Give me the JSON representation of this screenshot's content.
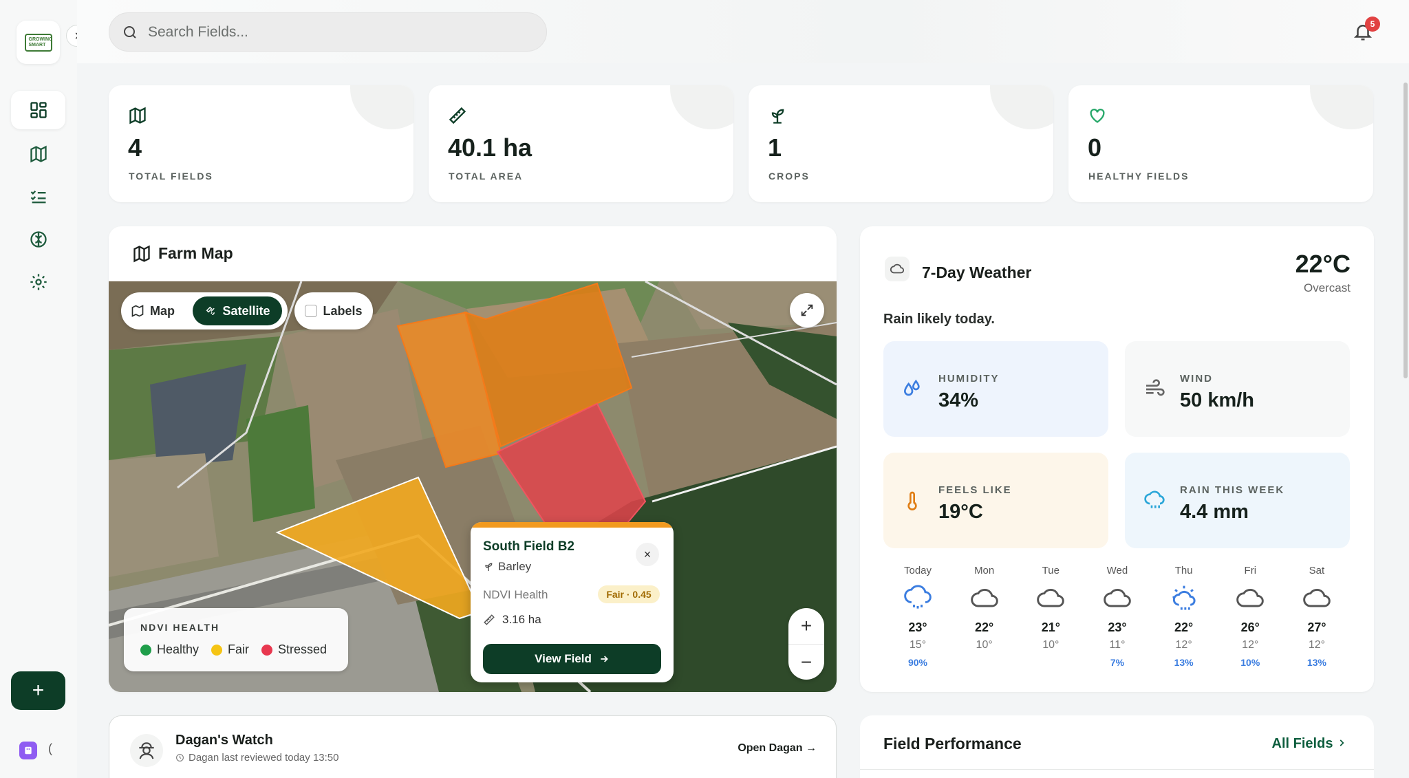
{
  "app": {
    "logo_text_1": "GROWING",
    "logo_text_2": "SMART"
  },
  "header": {
    "search_placeholder": "Search Fields...",
    "notification_count": "5"
  },
  "stats": [
    {
      "value": "4",
      "label": "TOTAL FIELDS",
      "icon": "map-icon"
    },
    {
      "value": "40.1 ha",
      "label": "TOTAL AREA",
      "icon": "ruler-icon"
    },
    {
      "value": "1",
      "label": "CROPS",
      "icon": "sprout-icon"
    },
    {
      "value": "0",
      "label": "HEALTHY FIELDS",
      "icon": "heart-icon"
    }
  ],
  "farm_map": {
    "title": "Farm Map",
    "toggle_map": "Map",
    "toggle_satellite": "Satellite",
    "labels": "Labels",
    "legend_title": "NDVI HEALTH",
    "legend": [
      {
        "label": "Healthy",
        "color": "#1f9e4a"
      },
      {
        "label": "Fair",
        "color": "#f5c414"
      },
      {
        "label": "Stressed",
        "color": "#e8384f"
      }
    ],
    "popup": {
      "title": "South Field B2",
      "crop": "Barley",
      "ndvi_label": "NDVI Health",
      "ndvi_badge": "Fair · 0.45",
      "area": "3.16 ha",
      "button": "View Field"
    },
    "zoom_in": "+",
    "zoom_out": "−"
  },
  "weather": {
    "title": "7-Day Weather",
    "temp": "22°C",
    "condition": "Overcast",
    "summary": "Rain likely today.",
    "metrics": [
      {
        "label": "HUMIDITY",
        "value": "34%"
      },
      {
        "label": "WIND",
        "value": "50 km/h"
      },
      {
        "label": "FEELS LIKE",
        "value": "19°C"
      },
      {
        "label": "RAIN THIS WEEK",
        "value": "4.4 mm"
      }
    ],
    "forecast": [
      {
        "day": "Today",
        "hi": "23°",
        "lo": "15°",
        "rain": "90%",
        "icon": "cloud-rain-icon"
      },
      {
        "day": "Mon",
        "hi": "22°",
        "lo": "10°",
        "rain": "",
        "icon": "cloud-icon"
      },
      {
        "day": "Tue",
        "hi": "21°",
        "lo": "10°",
        "rain": "",
        "icon": "cloud-icon"
      },
      {
        "day": "Wed",
        "hi": "23°",
        "lo": "11°",
        "rain": "7%",
        "icon": "cloud-icon"
      },
      {
        "day": "Thu",
        "hi": "22°",
        "lo": "12°",
        "rain": "13%",
        "icon": "cloud-sun-rain-icon"
      },
      {
        "day": "Fri",
        "hi": "26°",
        "lo": "12°",
        "rain": "10%",
        "icon": "cloud-icon"
      },
      {
        "day": "Sat",
        "hi": "27°",
        "lo": "12°",
        "rain": "13%",
        "icon": "cloud-icon"
      }
    ]
  },
  "watch": {
    "title": "Dagan's Watch",
    "subtitle": "Dagan last reviewed today 13:50",
    "link": "Open Dagan →"
  },
  "performance": {
    "title": "Field Performance",
    "link": "All Fields"
  },
  "colors": {
    "brand": "#0d3d27",
    "accent_orange": "#f29a1f",
    "rain_blue": "#3b7de0"
  }
}
